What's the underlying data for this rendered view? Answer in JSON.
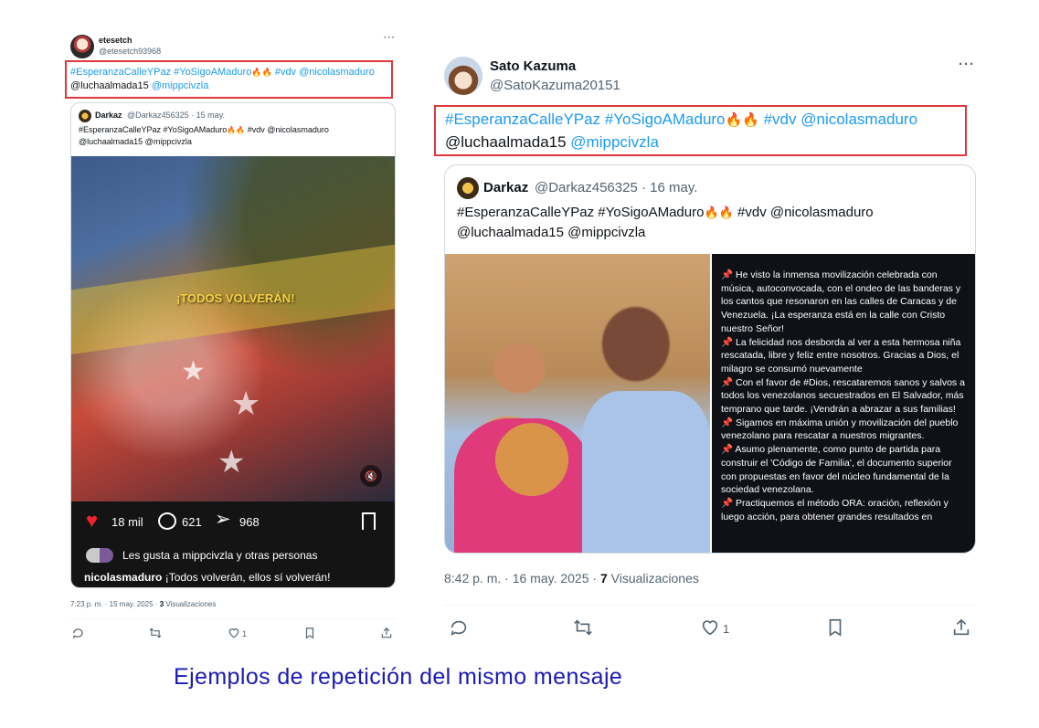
{
  "left_tweet": {
    "author_name": "etesetch",
    "author_handle": "@etesetch93968",
    "more": "···",
    "text_line1_hashtags": "#EsperanzaCalleYPaz #YoSigoAMaduro",
    "text_line1_tail": " #vdv @nicolasmaduro",
    "text_line2_user": "@luchaalmada15 ",
    "text_line2_mention": "@mippcivzla",
    "fire": "🔥🔥",
    "quote": {
      "author_name": "Darkaz",
      "meta": "@Darkaz456325 · 15 may.",
      "line1": "#EsperanzaCalleYPaz #YoSigoAMaduro",
      "line1_tail": " #vdv @nicolasmaduro",
      "line2": "@luchaalmada15 @mippcivzla",
      "video_overlay_text": "¡TODOS VOLVERÁN!",
      "likes": "18 mil",
      "comments": "621",
      "shares": "968",
      "liked_by": "Les gusta a mippcivzla y otras personas",
      "caption_user": "nicolasmaduro",
      "caption_text": " ¡Todos volverán, ellos sí volverán!"
    },
    "footer_time": "7:23 p. m. · 15 may. 2025 · ",
    "footer_views_count": "3",
    "footer_views_label": " Visualizaciones",
    "like_count": "1"
  },
  "right_tweet": {
    "author_name": "Sato Kazuma",
    "author_handle": "@SatoKazuma20151",
    "more": "···",
    "text_line1_hashtags": "#EsperanzaCalleYPaz #YoSigoAMaduro",
    "text_line1_tail": " #vdv @nicolasmaduro",
    "text_line2_user": "@luchaalmada15 ",
    "text_line2_mention": "@mippcivzla",
    "fire": "🔥🔥",
    "quote": {
      "author_name": "Darkaz",
      "meta": "@Darkaz456325 · 16 may.",
      "line1": "#EsperanzaCalleYPaz #YoSigoAMaduro",
      "line1_tail": " #vdv @nicolasmaduro",
      "line2": "@luchaalmada15 @mippcivzla",
      "panel_paragraphs": [
        "📌 He visto la inmensa movilización celebrada con música, autoconvocada, con el ondeo de las banderas y los cantos que resonaron en las calles de Caracas y de Venezuela. ¡La esperanza está en la calle con Cristo nuestro Señor!",
        "📌 La felicidad nos desborda al ver a esta hermosa niña rescatada, libre y feliz entre nosotros. Gracias a Dios, el milagro se consumó nuevamente",
        "📌 Con el favor de #Dios, rescataremos sanos y salvos a todos los venezolanos secuestrados en El Salvador, más temprano que tarde. ¡Vendrán a abrazar a sus familias!",
        "📌 Sigamos en máxima unión y movilización del pueblo venezolano para rescatar a nuestros migrantes.",
        "📌 Asumo plenamente, como punto de partida para construir el 'Código de Familia', el documento superior con propuestas en favor del núcleo fundamental de la sociedad venezolana.",
        "📌 Practiquemos el método ORA: oración, reflexión y luego acción, para obtener grandes resultados en"
      ]
    },
    "footer_time": "8:42 p. m. · 16 may. 2025 · ",
    "footer_views_count": "7",
    "footer_views_label": " Visualizaciones",
    "like_count": "1"
  },
  "caption": "Ejemplos de repetición del mismo mensaje",
  "colors": {
    "link_blue": "#1d9bf0",
    "red_highlight": "#e0383c",
    "caption_blue": "#1a1ab5",
    "like_red": "#f4212e"
  },
  "icons": [
    "reply-icon",
    "retweet-icon",
    "like-icon",
    "bookmark-icon",
    "share-icon",
    "mute-icon",
    "heart-icon",
    "comment-icon",
    "send-icon"
  ]
}
